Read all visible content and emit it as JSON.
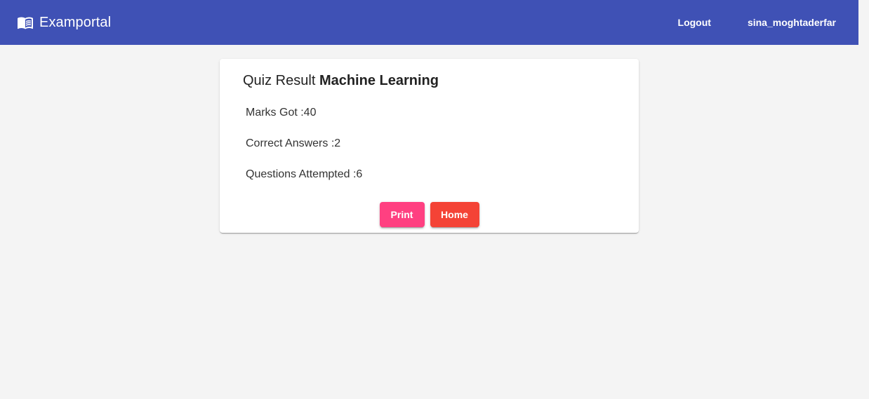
{
  "toolbar": {
    "brand_icon": "book-icon",
    "brand_title": "Examportal",
    "logout_label": "Logout",
    "username": "sina_moghtaderfar"
  },
  "result": {
    "title_prefix": "Quiz Result",
    "quiz_name": "Machine Learning",
    "marks_line": "Marks Got :40",
    "correct_line": "Correct Answers :2",
    "attempted_line": "Questions Attempted :6"
  },
  "actions": {
    "print_label": "Print",
    "home_label": "Home"
  },
  "colors": {
    "toolbar": "#3f51b5",
    "print_button": "#ff4081",
    "home_button": "#f44336",
    "background": "#f4f4f4"
  }
}
